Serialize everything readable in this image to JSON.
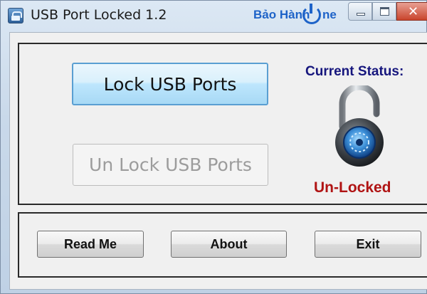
{
  "window": {
    "title": "USB Port Locked 1.2",
    "watermark": "Bảo Hành",
    "watermark_tail": "ne"
  },
  "main": {
    "lock_button": "Lock USB Ports",
    "unlock_button": "Un Lock USB Ports",
    "status_label": "Current Status:",
    "status_value": "Un-Locked",
    "status_icon": "padlock-open-icon"
  },
  "footer": {
    "readme_button": "Read Me",
    "about_button": "About",
    "exit_button": "Exit"
  },
  "colors": {
    "status_label": "#16167d",
    "status_value": "#b01414",
    "watermark": "#1e63c8",
    "lock_button_border": "#5a9fd2"
  }
}
